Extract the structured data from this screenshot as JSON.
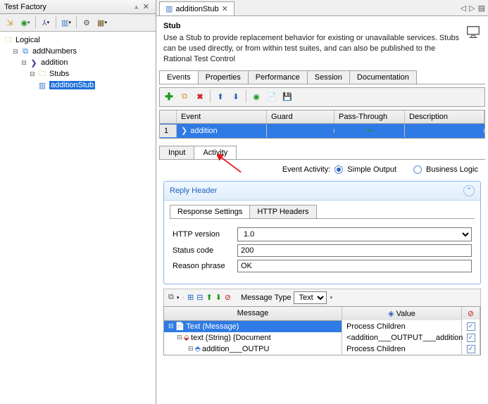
{
  "leftPanel": {
    "title": "Test Factory",
    "tree": {
      "root": "Logical",
      "n1": "addNumbers",
      "n2": "addition",
      "n3": "Stubs",
      "n4": "additionStub"
    }
  },
  "editorTab": {
    "title": "additionStub"
  },
  "stubBlock": {
    "heading": "Stub",
    "body": "Use a Stub to provide replacement behavior for existing or unavailable services. Stubs can be used directly, or from within test suites, and can also be published to the Rational Test Control"
  },
  "mainTabs": [
    "Events",
    "Properties",
    "Performance",
    "Session",
    "Documentation"
  ],
  "eventTable": {
    "headers": [
      "",
      "Event",
      "Guard",
      "Pass-Through",
      "Description"
    ],
    "row": {
      "num": "1",
      "event": "addition"
    }
  },
  "ioTabs": [
    "Input",
    "Activity"
  ],
  "activity": {
    "label": "Event Activity:",
    "opt1": "Simple Output",
    "opt2": "Business Logic"
  },
  "replyHeader": {
    "title": "Reply Header"
  },
  "rsTabs": [
    "Response Settings",
    "HTTP Headers"
  ],
  "form": {
    "httpVersionLabel": "HTTP version",
    "httpVersionValue": "1.0",
    "statusLabel": "Status code",
    "statusValue": "200",
    "reasonLabel": "Reason phrase",
    "reasonValue": "OK"
  },
  "msg": {
    "typeLabel": "Message Type",
    "typeValue": "Text",
    "headers": [
      "Message",
      "Value",
      ""
    ],
    "r1": {
      "c0": "Text (Message)",
      "c1": "Process Children"
    },
    "r2": {
      "c0": "text (String) {Document",
      "c1": "<addition___OUTPUT___addition"
    },
    "r3": {
      "c0": "addition___OUTPU",
      "c1": "Process Children"
    }
  }
}
